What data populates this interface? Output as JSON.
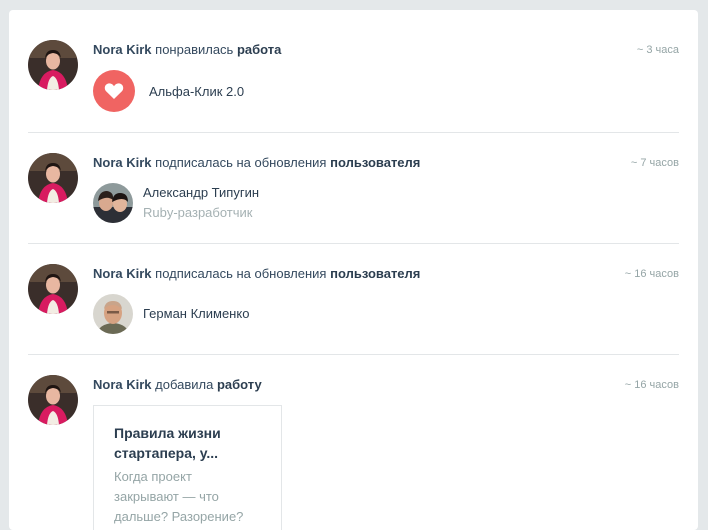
{
  "feed": [
    {
      "actor": "Nora Kirk",
      "action": "понравилась",
      "object": "работа",
      "time": "~ 3 часа",
      "work_title": "Альфа-Клик 2.0"
    },
    {
      "actor": "Nora Kirk",
      "action": "подписалась на обновления",
      "object": "пользователя",
      "time": "~ 7 часов",
      "user_name": "Александр Типугин",
      "user_role": "Ruby-разработчик"
    },
    {
      "actor": "Nora Kirk",
      "action": "подписалась на обновления",
      "object": "пользователя",
      "time": "~ 16 часов",
      "user_name": "Герман Клименко"
    },
    {
      "actor": "Nora Kirk",
      "action": "добавила",
      "object": "работу",
      "time": "~ 16 часов",
      "post_title": "Правила жизни стартапера, у...",
      "post_excerpt": "Когда проект закрывают — что дальше? Разорение?"
    }
  ],
  "colors": {
    "like_accent": "#f06462",
    "muted_text": "#95a5a6",
    "page_background": "#e4e8ea"
  },
  "icons": {
    "like": "heart-icon"
  }
}
